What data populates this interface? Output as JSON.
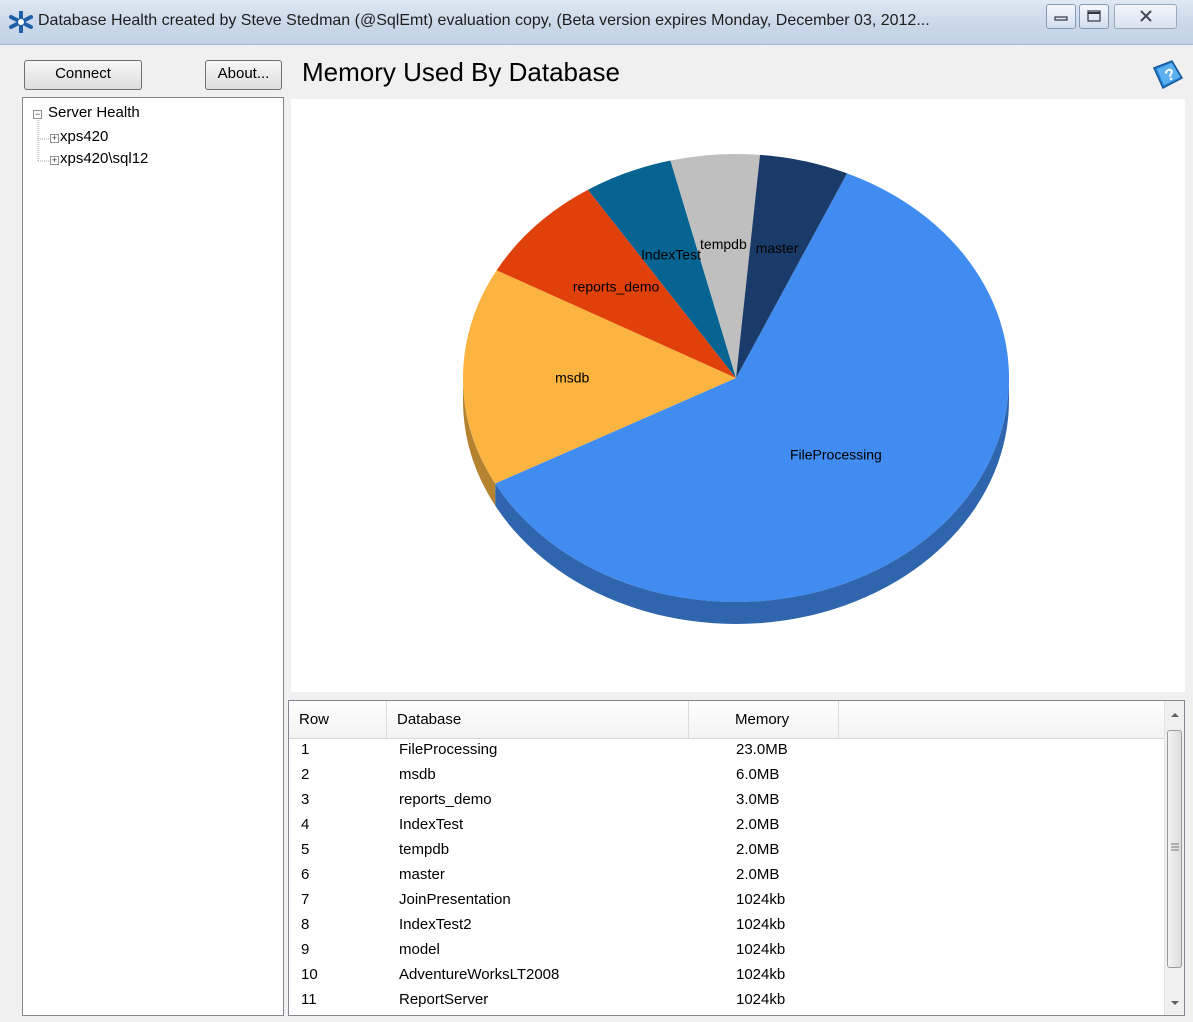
{
  "window": {
    "title": "Database Health created by Steve Stedman (@SqlEmt) evaluation copy, (Beta version expires Monday, December 03, 2012..."
  },
  "toolbar": {
    "connect_label": "Connect",
    "about_label": "About..."
  },
  "tree": {
    "root_label": "Server Health",
    "servers": [
      "xps420",
      "xps420\\sql12"
    ]
  },
  "main": {
    "title": "Memory Used By Database"
  },
  "grid": {
    "columns": [
      "Row",
      "Database",
      "Memory"
    ],
    "rows": [
      [
        "1",
        "FileProcessing",
        "23.0MB"
      ],
      [
        "2",
        "msdb",
        "6.0MB"
      ],
      [
        "3",
        "reports_demo",
        "3.0MB"
      ],
      [
        "4",
        "IndexTest",
        "2.0MB"
      ],
      [
        "5",
        "tempdb",
        "2.0MB"
      ],
      [
        "6",
        "master",
        "2.0MB"
      ],
      [
        "7",
        "JoinPresentation",
        "1024kb"
      ],
      [
        "8",
        "IndexTest2",
        "1024kb"
      ],
      [
        "9",
        "model",
        "1024kb"
      ],
      [
        "10",
        "AdventureWorksLT2008",
        "1024kb"
      ],
      [
        "11",
        "ReportServer",
        "1024kb"
      ]
    ]
  },
  "chart_data": {
    "type": "pie",
    "title": "",
    "categories": [
      "FileProcessing",
      "msdb",
      "reports_demo",
      "IndexTest",
      "tempdb",
      "master"
    ],
    "values": [
      23.0,
      6.0,
      3.0,
      2.0,
      2.0,
      2.0
    ],
    "unit": "MB",
    "colors": [
      "#418cf0",
      "#fcb441",
      "#e0400a",
      "#056492",
      "#bfbfbf",
      "#1a3b69"
    ],
    "start_angle_deg": 294,
    "style": "3d"
  }
}
